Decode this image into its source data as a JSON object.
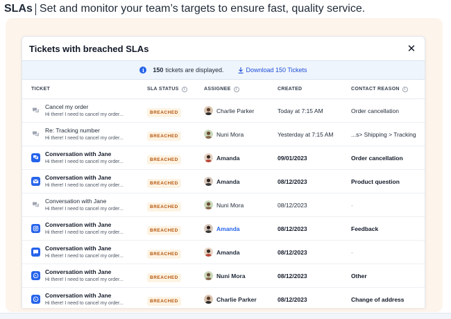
{
  "header": {
    "title": "SLAs",
    "subtitle": "Set and monitor your team’s targets to ensure fast, quality service."
  },
  "modal": {
    "title": "Tickets with breached SLAs",
    "close_icon": "close-icon",
    "info": {
      "count": "150",
      "count_suffix": "tickets are displayed.",
      "download_label": "Download 150 Tickets"
    },
    "columns": {
      "ticket": "TICKET",
      "sla_status": "SLA STATUS",
      "assignee": "ASSIGNEE",
      "created": "CREATED",
      "contact_reason": "CONTACT REASON"
    },
    "rows": [
      {
        "channel_icon": "chat-bubble-icon",
        "subject": "Cancel my order",
        "preview": "Hi there! I need to cancel my order...",
        "status": "BREACHED",
        "assignee": "Charlie Parker",
        "created": "Today at 7:15 AM",
        "reason": "Order cancellation"
      },
      {
        "channel_icon": "chat-bubble-icon",
        "subject": "Re: Tracking number",
        "preview": "Hi there! I need to cancel my order...",
        "status": "BREACHED",
        "assignee": "Nuni Mora",
        "created": "Yesterday at 7:15 AM",
        "reason": "...s> Shipping > Tracking"
      },
      {
        "channel_icon": "chat-icon",
        "subject": "Conversation with Jane",
        "preview": "Hi there! I need to cancel my order...",
        "status": "BREACHED",
        "assignee": "Amanda",
        "created": "09/01/2023",
        "reason": "Order cancellation"
      },
      {
        "channel_icon": "email-icon",
        "subject": "Conversation with Jane",
        "preview": "Hi there! I need to cancel my order...",
        "status": "BREACHED",
        "assignee": "Amanda",
        "created": "08/12/2023",
        "reason": "Product question"
      },
      {
        "channel_icon": "chat-bubble-icon",
        "subject": "Conversation with Jane",
        "preview": "Hi there! I need to cancel my order...",
        "status": "BREACHED",
        "assignee": "Nuni Mora",
        "created": "08/12/2023",
        "reason": "-"
      },
      {
        "channel_icon": "instagram-icon",
        "subject": "Conversation with Jane",
        "preview": "Hi there! I need to cancel my order...",
        "status": "BREACHED",
        "assignee": "Amanda",
        "created": "08/12/2023",
        "reason": "Feedback"
      },
      {
        "channel_icon": "message-icon",
        "subject": "Conversation with Jane",
        "preview": "Hi there! I need to cancel my order...",
        "status": "BREACHED",
        "assignee": "Amanda",
        "created": "08/12/2023",
        "reason": "-"
      },
      {
        "channel_icon": "whatsapp-icon",
        "subject": "Conversation with Jane",
        "preview": "Hi there! I need to cancel my order...",
        "status": "BREACHED",
        "assignee": "Nuni Mora",
        "created": "08/12/2023",
        "reason": "Other"
      },
      {
        "channel_icon": "whatsapp-icon",
        "subject": "Conversation with Jane",
        "preview": "Hi there! I need to cancel my order...",
        "status": "BREACHED",
        "assignee": "Charlie Parker",
        "created": "08/12/2023",
        "reason": "Change of address"
      }
    ]
  },
  "colors": {
    "accent": "#2563eb",
    "breached_bg": "#fdf3e3",
    "breached_text": "#b45309",
    "backdrop": "#fdf4ec",
    "info_bar": "#eff5fc"
  }
}
